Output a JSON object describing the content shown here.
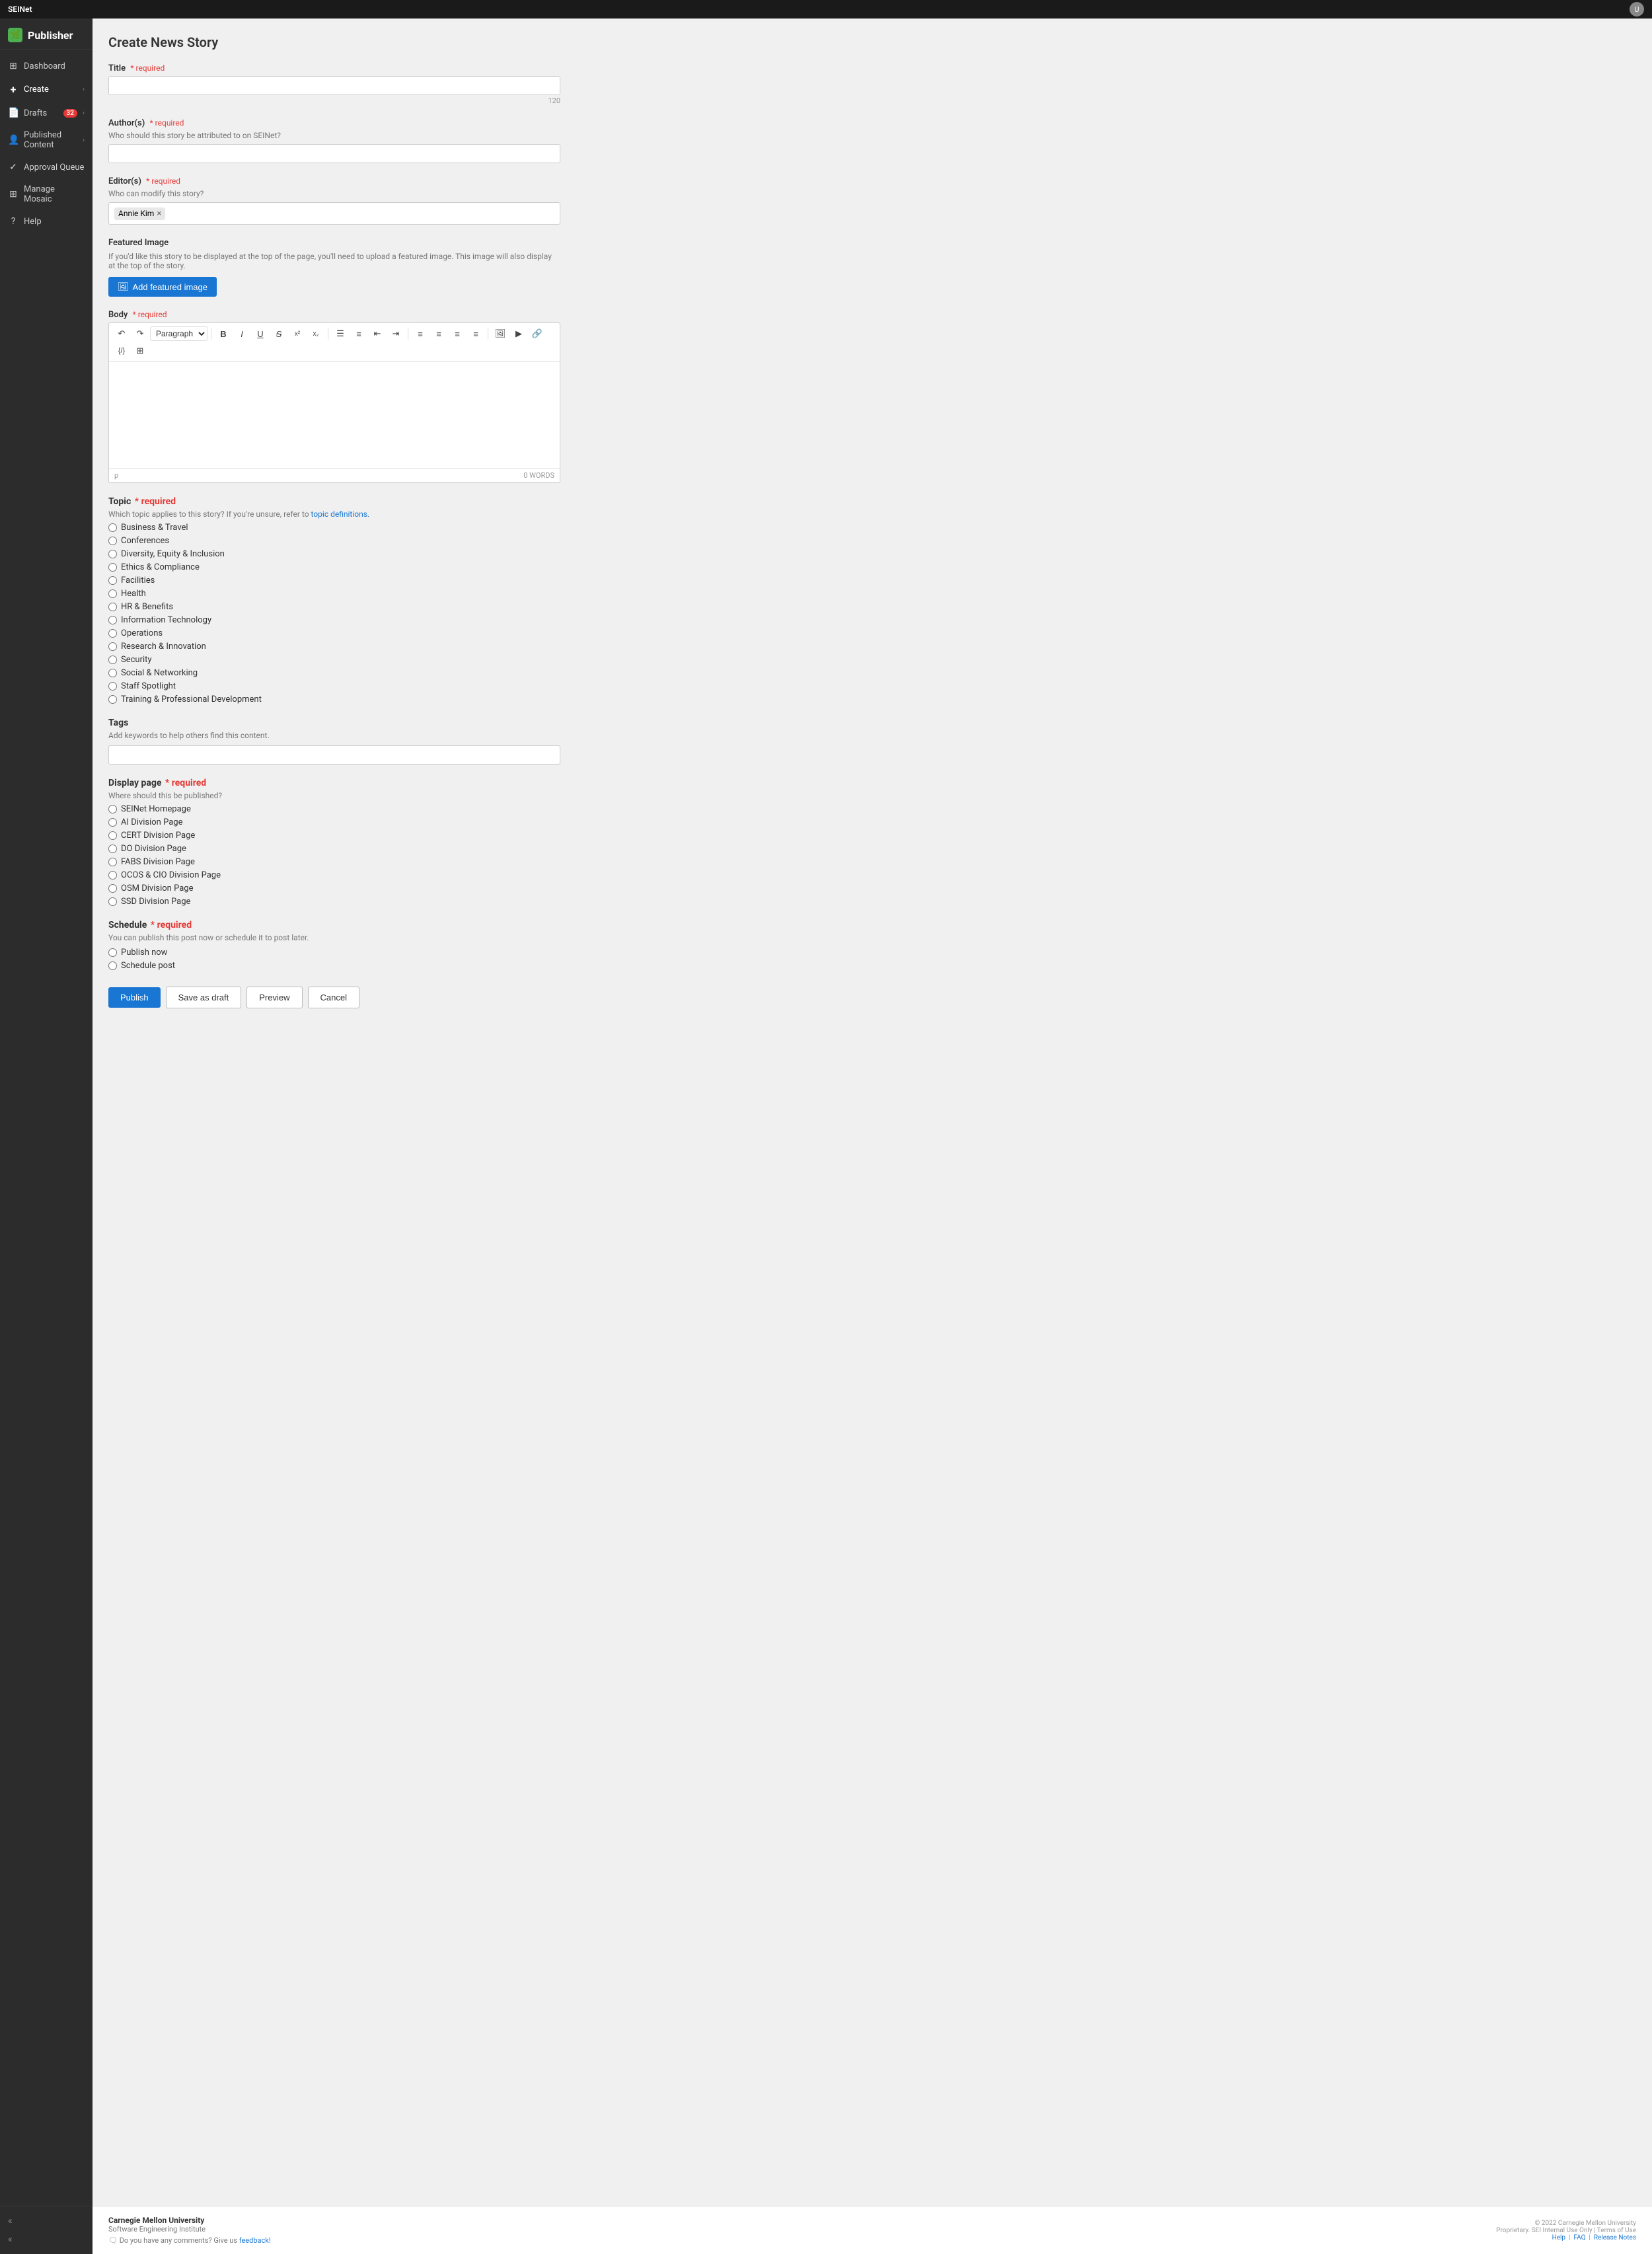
{
  "topnav": {
    "app_name": "SEINet",
    "avatar_initials": "U"
  },
  "sidebar": {
    "brand": "Publisher",
    "brand_icon": "🌿",
    "items": [
      {
        "id": "dashboard",
        "label": "Dashboard",
        "icon": "⊞",
        "badge": null,
        "arrow": false
      },
      {
        "id": "create",
        "label": "Create",
        "icon": "+",
        "badge": null,
        "arrow": true
      },
      {
        "id": "drafts",
        "label": "Drafts",
        "icon": "📄",
        "badge": "32",
        "arrow": true
      },
      {
        "id": "published",
        "label": "Published Content",
        "icon": "👤",
        "badge": null,
        "arrow": true
      },
      {
        "id": "approval",
        "label": "Approval Queue",
        "icon": "✓",
        "badge": null,
        "arrow": false
      },
      {
        "id": "mosaic",
        "label": "Manage Mosaic",
        "icon": "⊞",
        "badge": null,
        "arrow": false
      },
      {
        "id": "help",
        "label": "Help",
        "icon": "?",
        "badge": null,
        "arrow": false
      }
    ]
  },
  "form": {
    "page_title": "Create News Story",
    "title_field": {
      "label": "Title",
      "required": "* required",
      "placeholder": "",
      "counter": "120"
    },
    "authors_field": {
      "label": "Author(s)",
      "required": "* required",
      "hint": "Who should this story be attributed to on SEINet?",
      "placeholder": ""
    },
    "editors_field": {
      "label": "Editor(s)",
      "required": "* required",
      "hint": "Who can modify this story?",
      "value": "Annie Kim"
    },
    "featured_image": {
      "label": "Featured Image",
      "hint": "If you'd like this story to be displayed at the top of the page, you'll need to upload a featured image. This image will also display at the top of the story.",
      "button_label": "Add featured image"
    },
    "body_field": {
      "label": "Body",
      "required": "* required",
      "word_count": "0 WORDS",
      "paragraph_label": "Paragraph",
      "footer_p": "p"
    },
    "topic_field": {
      "label": "Topic",
      "required": "* required",
      "hint_prefix": "Which topic applies to this story? If you're unsure, refer to ",
      "hint_link": "topic definitions.",
      "hint_link_url": "#",
      "options": [
        "Business & Travel",
        "Conferences",
        "Diversity, Equity & Inclusion",
        "Ethics & Compliance",
        "Facilities",
        "Health",
        "HR & Benefits",
        "Information Technology",
        "Operations",
        "Research & Innovation",
        "Security",
        "Social & Networking",
        "Staff Spotlight",
        "Training & Professional Development"
      ]
    },
    "tags_field": {
      "label": "Tags",
      "hint": "Add keywords to help others find this content.",
      "placeholder": ""
    },
    "display_page_field": {
      "label": "Display page",
      "required": "* required",
      "hint": "Where should this be published?",
      "options": [
        "SEINet Homepage",
        "AI Division Page",
        "CERT Division Page",
        "DO Division Page",
        "FABS Division Page",
        "OCOS & CIO Division Page",
        "OSM Division Page",
        "SSD Division Page"
      ]
    },
    "schedule_field": {
      "label": "Schedule",
      "required": "* required",
      "hint": "You can publish this post now or schedule it to post later.",
      "options": [
        "Publish now",
        "Schedule post"
      ]
    },
    "buttons": {
      "publish": "Publish",
      "save_draft": "Save as draft",
      "preview": "Preview",
      "cancel": "Cancel"
    }
  },
  "footer": {
    "brand": "Carnegie Mellon University",
    "sub": "Software Engineering Institute",
    "feedback_prefix": "Do you have any comments? Give us ",
    "feedback_link": "feedback!",
    "copyright": "© 2022 Carnegie Mellon University",
    "legal": "Proprietary. SEI Internal Use Only  |  Terms of Use",
    "links": "Help  |  FAQ  |  Release Notes"
  },
  "toolbar": {
    "undo": "↶",
    "redo": "↷",
    "bold": "B",
    "italic": "I",
    "underline": "U",
    "superscript": "x²",
    "subscript": "x₂",
    "ul": "≡",
    "ol": "≡",
    "indent_left": "⇤",
    "indent_right": "⇥",
    "align_left": "≡",
    "align_center": "≡",
    "align_right": "≡",
    "justify": "≡",
    "image": "🖼",
    "media": "▶",
    "link": "🔗",
    "code": "</>",
    "table": "⊞"
  }
}
